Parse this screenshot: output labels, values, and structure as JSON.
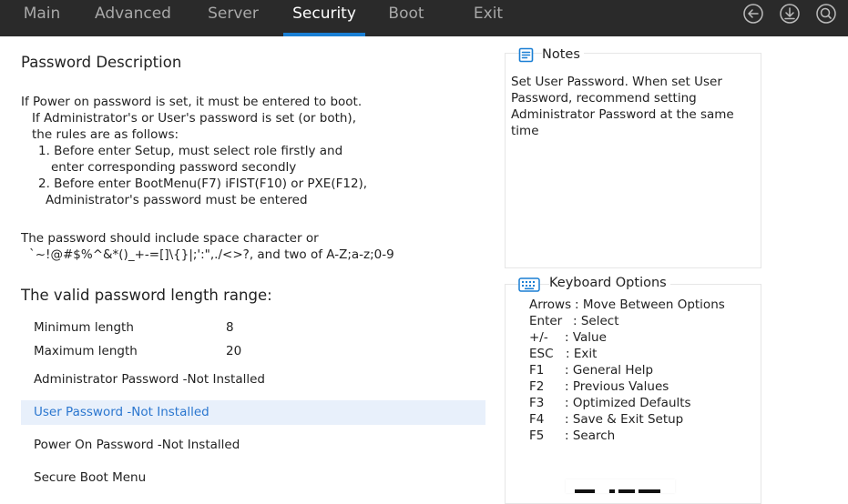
{
  "tabs": [
    "Main",
    "Advanced",
    "Server",
    "Security",
    "Boot",
    "Exit"
  ],
  "active_tab": "Security",
  "accent_color": "#1a7fd4",
  "top_icons": [
    "back-circle-icon",
    "download-circle-icon",
    "search-circle-icon"
  ],
  "main": {
    "password_description_title": "Password Description",
    "desc_lines": [
      "If Power on password is set, it must be entered to boot.",
      "If Administrator's or User's password is set (or both),",
      "the rules are as follows:",
      "1. Before enter Setup, must select role firstly and",
      "enter corresponding password secondly",
      "2. Before enter BootMenu(F7) iFIST(F10) or PXE(F12),",
      "Administrator's password must be entered"
    ],
    "charset_lines": [
      "The password should include space character or",
      "`~!@#$%^&*()_+-=[]\\{}|;':\",./<>?, and two of A-Z;a-z;0-9"
    ],
    "length_title": "The valid password length range:",
    "min_label": "Minimum length",
    "min_value": "8",
    "max_label": "Maximum length",
    "max_value": "20",
    "items": [
      "Administrator Password -Not Installed",
      "User Password -Not Installed",
      "Power On Password -Not Installed",
      "Secure Boot Menu"
    ],
    "selected_item": "User Password -Not Installed"
  },
  "notes": {
    "title": "Notes",
    "lines": [
      "Set User Password. When set User",
      "Password, recommend setting",
      "Administrator Password at the same",
      "time"
    ]
  },
  "keyboard": {
    "title": "Keyboard Options",
    "rows": [
      {
        "key": "Arrows",
        "desc": ": Move Between Options"
      },
      {
        "key": "Enter",
        "desc": ": Select"
      },
      {
        "key": "+/-",
        "desc": ": Value"
      },
      {
        "key": "ESC",
        "desc": ": Exit"
      },
      {
        "key": "F1",
        "desc": ": General Help"
      },
      {
        "key": "F2",
        "desc": ": Previous Values"
      },
      {
        "key": "F3",
        "desc": ": Optimized Defaults"
      },
      {
        "key": "F4",
        "desc": ": Save & Exit Setup"
      },
      {
        "key": "F5",
        "desc": ": Search"
      }
    ]
  }
}
